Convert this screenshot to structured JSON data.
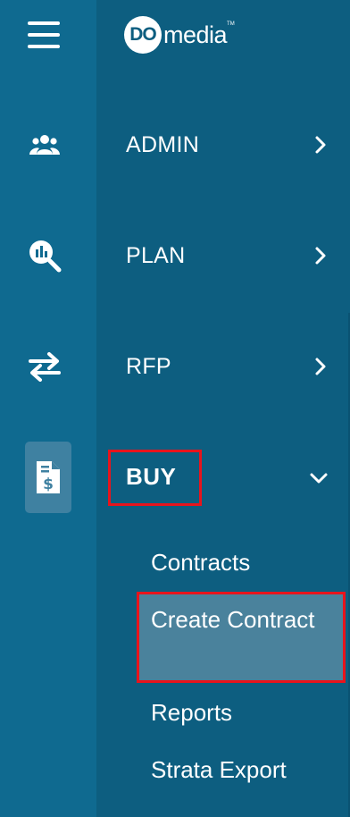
{
  "brand": {
    "logo_do": "DO",
    "logo_media": "media",
    "logo_tm": "TM"
  },
  "rail": {
    "items": [
      {
        "icon": "menu-icon"
      },
      {
        "icon": "users-icon"
      },
      {
        "icon": "analytics-search-icon"
      },
      {
        "icon": "transfer-arrows-icon"
      },
      {
        "icon": "invoice-dollar-icon"
      }
    ]
  },
  "nav": {
    "items": [
      {
        "label": "ADMIN",
        "icon": "chevron-right-icon"
      },
      {
        "label": "PLAN",
        "icon": "chevron-right-icon"
      },
      {
        "label": "RFP",
        "icon": "chevron-right-icon"
      },
      {
        "label": "BUY",
        "icon": "chevron-down-icon"
      }
    ],
    "buy_subitems": [
      {
        "label": "Contracts"
      },
      {
        "label": "Create Contract"
      },
      {
        "label": "Reports"
      },
      {
        "label": "Strata Export"
      }
    ]
  },
  "colors": {
    "rail_bg": "#0f6a90",
    "panel_bg": "#0d5e80",
    "active_bg": "#3f81a1",
    "selected_bg": "#4a829c",
    "highlight_border": "#e8141c"
  }
}
